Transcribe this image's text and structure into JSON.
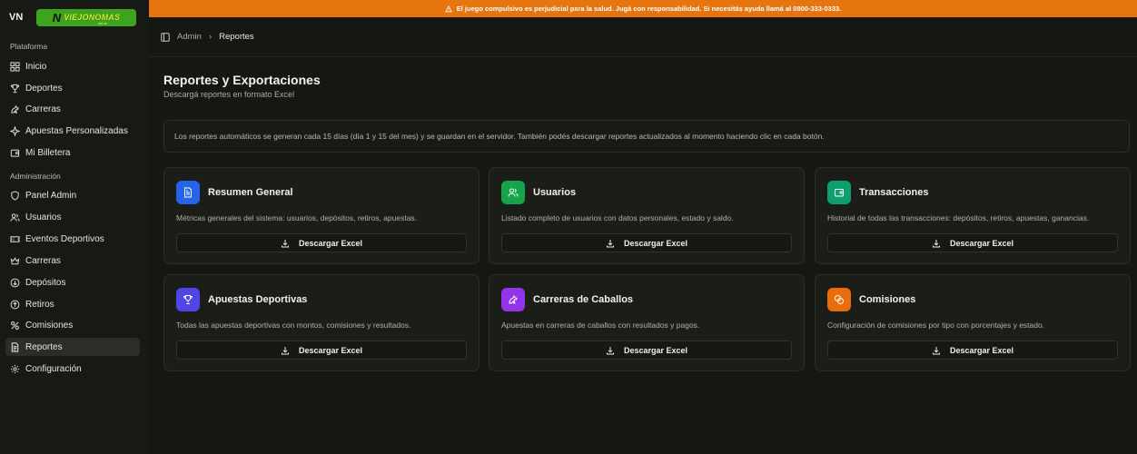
{
  "brand": {
    "short": "VN",
    "logo_text": "VIEJONOMAS",
    "logo_suffix": "bet.ar"
  },
  "banner": {
    "text": "El juego compulsivo es perjudicial para la salud. Jugá con responsabilidad. Si necesitás ayuda llamá al 0800-333-0333."
  },
  "sidebar": {
    "section_platform": "Plataforma",
    "platform_items": [
      {
        "label": "Inicio",
        "icon": "grid-icon"
      },
      {
        "label": "Deportes",
        "icon": "trophy-icon"
      },
      {
        "label": "Carreras",
        "icon": "horse-icon"
      },
      {
        "label": "Apuestas Personalizadas",
        "icon": "sparkle-icon"
      },
      {
        "label": "Mi Billetera",
        "icon": "wallet-icon"
      }
    ],
    "section_admin": "Administración",
    "admin_items": [
      {
        "label": "Panel Admin",
        "icon": "shield-icon"
      },
      {
        "label": "Usuarios",
        "icon": "users-icon"
      },
      {
        "label": "Eventos Deportivos",
        "icon": "ticket-icon"
      },
      {
        "label": "Carreras",
        "icon": "crown-icon"
      },
      {
        "label": "Depósitos",
        "icon": "arrow-down-circle-icon"
      },
      {
        "label": "Retiros",
        "icon": "arrow-up-circle-icon"
      },
      {
        "label": "Comisiones",
        "icon": "percent-icon"
      },
      {
        "label": "Reportes",
        "icon": "file-icon"
      },
      {
        "label": "Configuración",
        "icon": "gear-icon"
      }
    ]
  },
  "breadcrumb": {
    "root": "Admin",
    "current": "Reportes"
  },
  "page": {
    "title": "Reportes y Exportaciones",
    "subtitle": "Descargá reportes en formato Excel",
    "info": "Los reportes automáticos se generan cada 15 días (día 1 y 15 del mes) y se guardan en el servidor. También podés descargar reportes actualizados al momento haciendo clic en cada botón."
  },
  "cards": [
    {
      "title": "Resumen General",
      "desc": "Métricas generales del sistema: usuarios, depósitos, retiros, apuestas.",
      "button": "Descargar Excel",
      "color": "#2563eb",
      "icon": "report-icon"
    },
    {
      "title": "Usuarios",
      "desc": "Listado completo de usuarios con datos personales, estado y saldo.",
      "button": "Descargar Excel",
      "color": "#16a34a",
      "icon": "users-icon"
    },
    {
      "title": "Transacciones",
      "desc": "Historial de todas las transacciones: depósitos, retiros, apuestas, ganancias.",
      "button": "Descargar Excel",
      "color": "#0f9f6e",
      "icon": "wallet-icon"
    },
    {
      "title": "Apuestas Deportivas",
      "desc": "Todas las apuestas deportivas con montos, comisiones y resultados.",
      "button": "Descargar Excel",
      "color": "#4f46e5",
      "icon": "trophy-icon"
    },
    {
      "title": "Carreras de Caballos",
      "desc": "Apuestas en carreras de caballos con resultados y pagos.",
      "button": "Descargar Excel",
      "color": "#9333ea",
      "icon": "horse-icon"
    },
    {
      "title": "Comisiones",
      "desc": "Configuración de comisiones por tipo con porcentajes y estado.",
      "button": "Descargar Excel",
      "color": "#ea6c0a",
      "icon": "coins-icon"
    }
  ]
}
